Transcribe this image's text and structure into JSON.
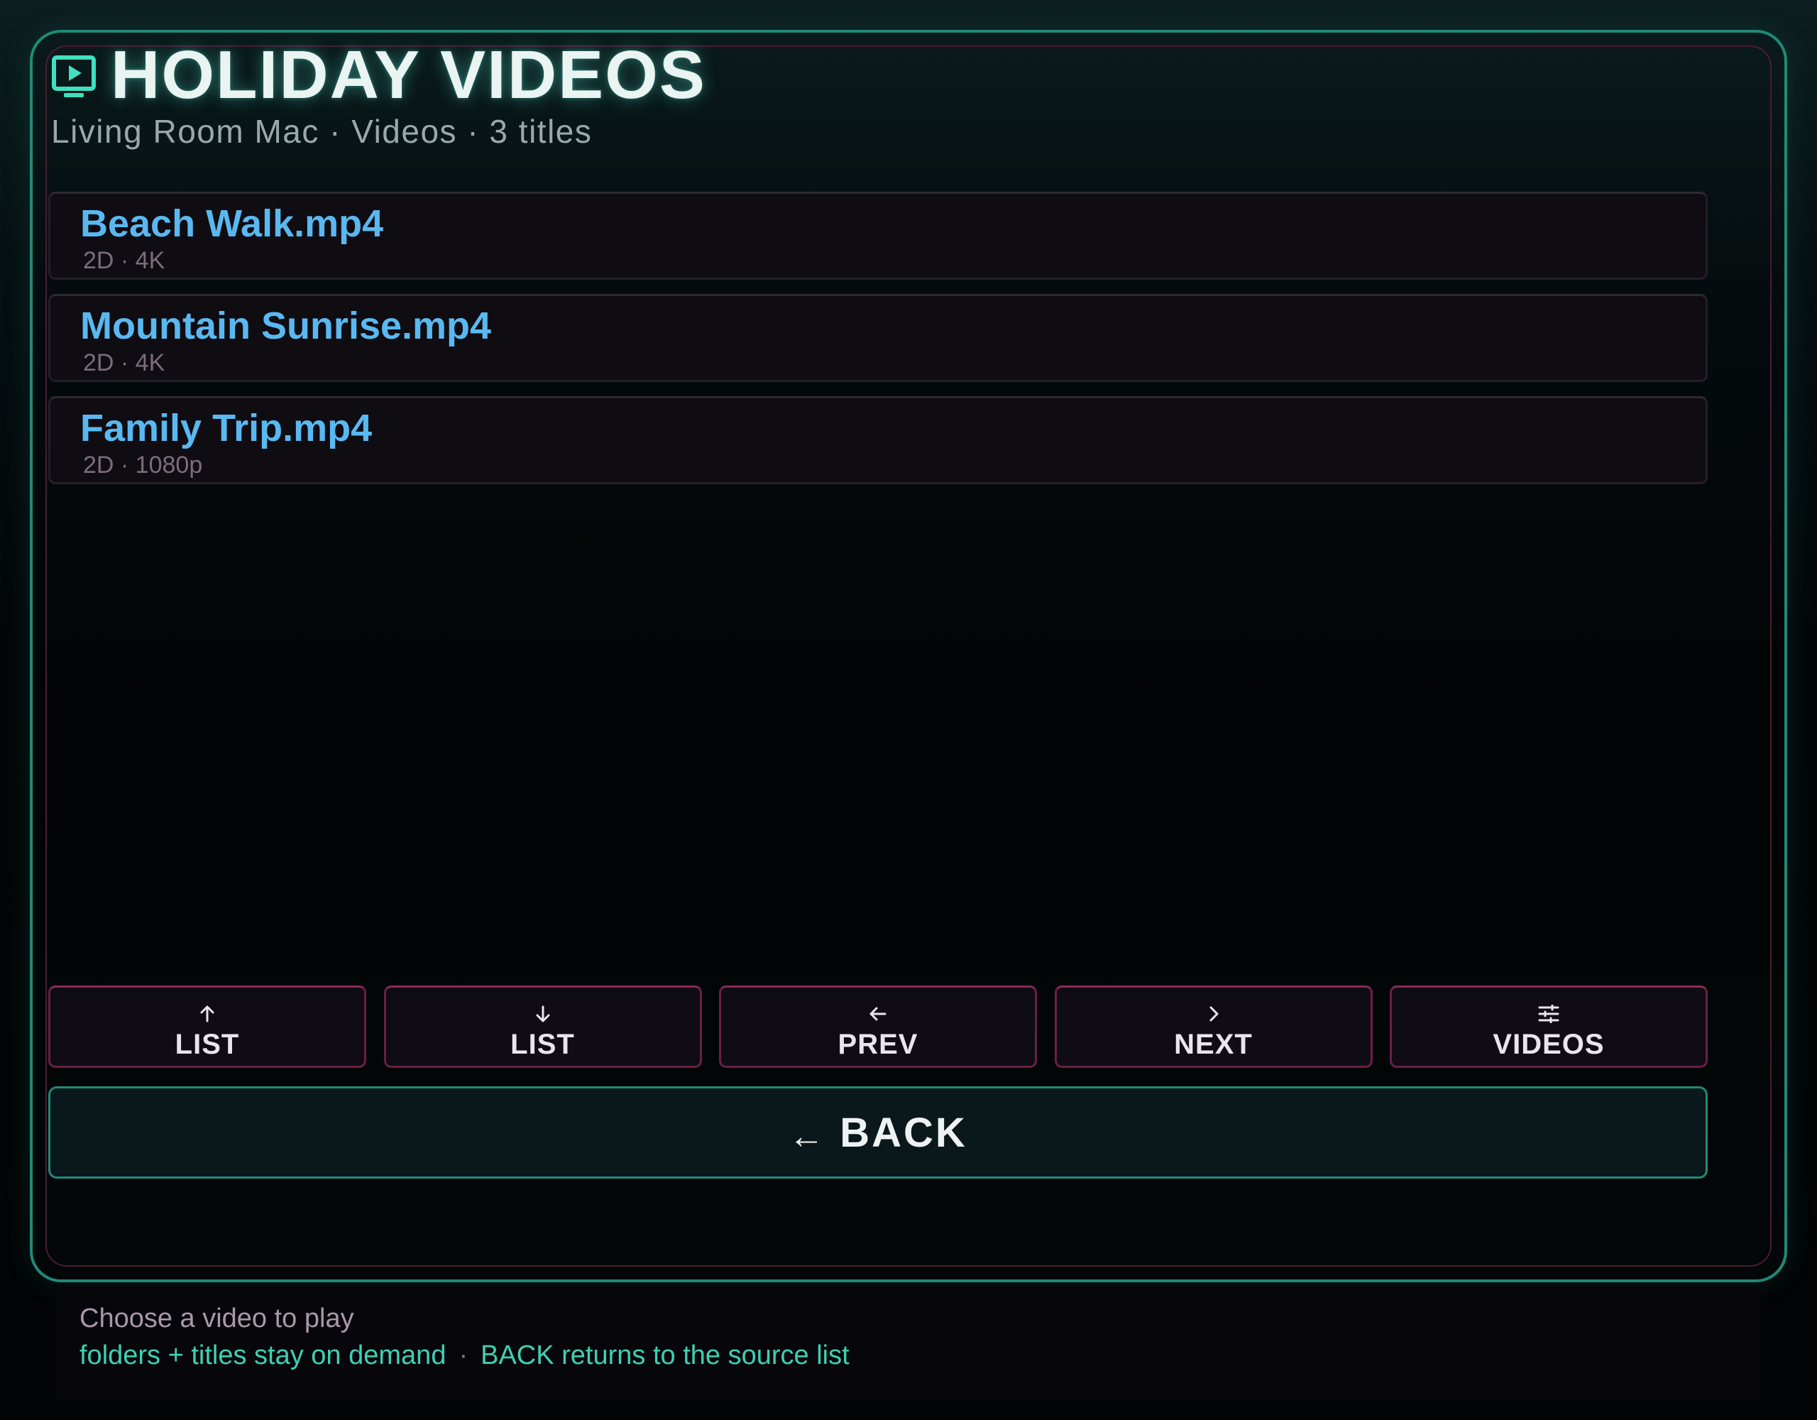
{
  "header": {
    "icon": "tv-play-icon",
    "title": "HOLIDAY VIDEOS",
    "subtitle": "Living Room Mac · Videos · 3 titles"
  },
  "files": [
    {
      "name": "Beach Walk.mp4",
      "meta": "2D · 4K"
    },
    {
      "name": "Mountain Sunrise.mp4",
      "meta": "2D · 4K"
    },
    {
      "name": "Family Trip.mp4",
      "meta": "2D · 1080p"
    }
  ],
  "controls": [
    {
      "icon": "arrow-up-icon",
      "label": "LIST"
    },
    {
      "icon": "arrow-down-icon",
      "label": "LIST"
    },
    {
      "icon": "arrow-left-icon",
      "label": "PREV"
    },
    {
      "icon": "chevron-right-icon",
      "label": "NEXT"
    },
    {
      "icon": "sliders-icon",
      "label": "VIDEOS"
    }
  ],
  "back": {
    "arrow": "←",
    "label": "BACK"
  },
  "footer": {
    "hint": "Choose a video to play",
    "tip_left": "folders + titles stay on demand",
    "separator": "·",
    "tip_right": "BACK returns to the source list"
  },
  "colors": {
    "accent_teal": "#1f8a78",
    "accent_magenta": "#6a1f48",
    "file_name_blue": "#5ab8f0",
    "hint_teal": "#3fd0b2"
  }
}
